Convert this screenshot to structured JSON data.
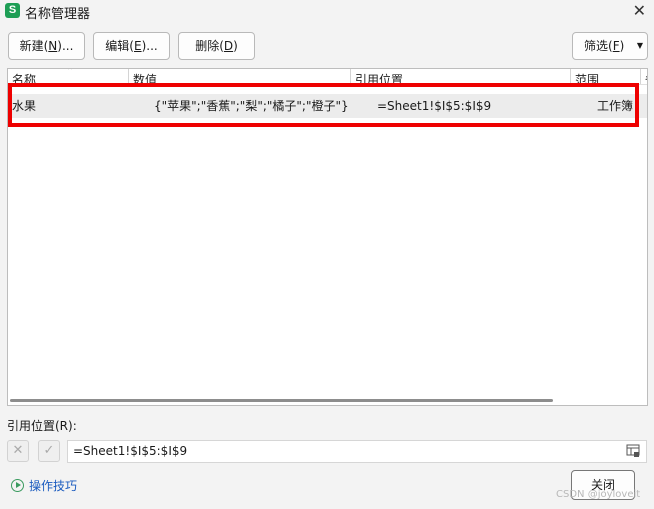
{
  "window": {
    "app_icon_letter": "S",
    "title": "名称管理器",
    "close_glyph": "✕"
  },
  "toolbar": {
    "new_prefix": "新建(",
    "new_key": "N",
    "new_suffix": ")...",
    "edit_prefix": "编辑(",
    "edit_key": "E",
    "edit_suffix": ")...",
    "delete_prefix": "删除(",
    "delete_key": "D",
    "delete_suffix": ")",
    "filter_prefix": "筛选(",
    "filter_key": "F",
    "filter_suffix": ")",
    "filter_arrow": "▼"
  },
  "table": {
    "columns": [
      "名称",
      "数值",
      "引用位置",
      "范围",
      "备"
    ],
    "sort_indicator": "⌃",
    "rows": [
      {
        "name": "水果",
        "value": "{\"苹果\";\"香蕉\";\"梨\";\"橘子\";\"橙子\"}",
        "refers_to": "=Sheet1!$I$5:$I$9",
        "scope": "工作簿"
      }
    ]
  },
  "reference": {
    "label": "引用位置(R):",
    "cancel_glyph": "✕",
    "confirm_glyph": "✓",
    "value": "=Sheet1!$I$5:$I$9"
  },
  "footer": {
    "tips_label": "操作技巧",
    "close_label": "关闭",
    "watermark": "CSDN @joyloveit"
  },
  "colors": {
    "highlight": "#ee0000",
    "app_icon": "#1e9e55",
    "link": "#1a5bbf"
  }
}
